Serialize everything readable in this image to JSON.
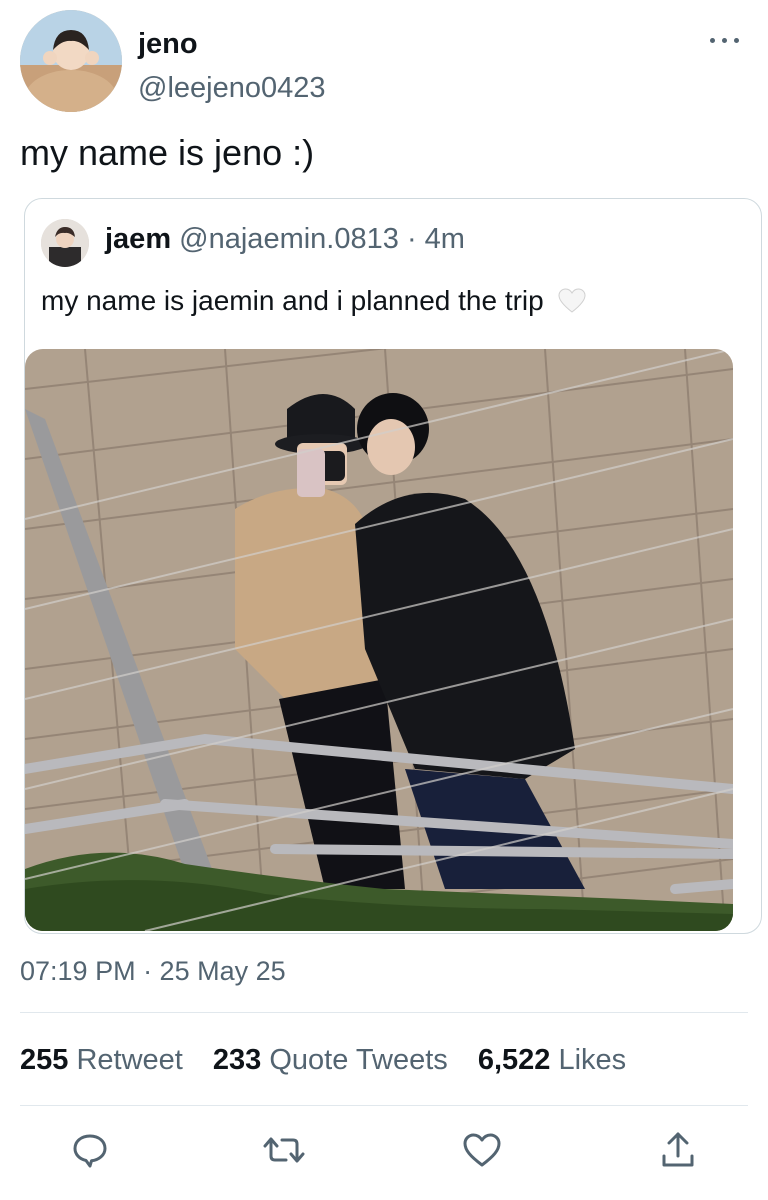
{
  "author": {
    "name": "jeno",
    "handle": "@leejeno0423"
  },
  "tweet": {
    "text": "my name is jeno :)"
  },
  "quote": {
    "name": "jaem",
    "handle": "@najaemin.0813",
    "dot": "·",
    "time": "4m",
    "text": "my name is jaemin and i planned the trip",
    "emoji": "white-heart-icon"
  },
  "meta": {
    "timestamp": "07:19 PM · 25 May 25"
  },
  "stats": {
    "retweet_count": "255",
    "retweet_label": "Retweet",
    "quote_count": "233",
    "quote_label": "Quote Tweets",
    "likes_count": "6,522",
    "likes_label": "Likes"
  },
  "actions": [
    "reply-icon",
    "retweet-icon",
    "like-icon",
    "share-icon"
  ],
  "colors": {
    "text": "#0f1419",
    "secondary": "#536471",
    "border": "#cfd9de"
  }
}
